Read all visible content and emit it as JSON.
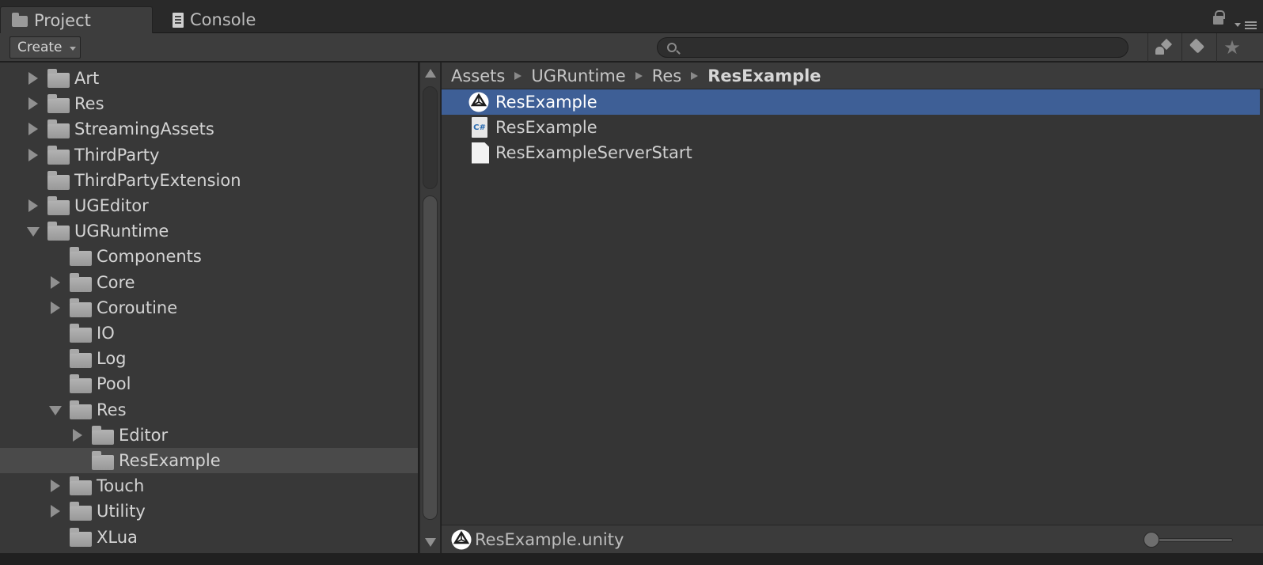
{
  "tabs": [
    {
      "label": "Project",
      "icon": "folder-icon",
      "active": true
    },
    {
      "label": "Console",
      "icon": "console-icon",
      "active": false
    }
  ],
  "toolbar": {
    "create_label": "Create",
    "search_placeholder": "",
    "icons": [
      "search-icon",
      "filter-by-type-icon",
      "filter-by-label-icon",
      "favorites-star-icon"
    ]
  },
  "tree": {
    "items": [
      {
        "label": "Art",
        "depth": 0,
        "expander": "collapsed"
      },
      {
        "label": "Res",
        "depth": 0,
        "expander": "collapsed"
      },
      {
        "label": "StreamingAssets",
        "depth": 0,
        "expander": "collapsed"
      },
      {
        "label": "ThirdParty",
        "depth": 0,
        "expander": "collapsed"
      },
      {
        "label": "ThirdPartyExtension",
        "depth": 0,
        "expander": "none"
      },
      {
        "label": "UGEditor",
        "depth": 0,
        "expander": "collapsed"
      },
      {
        "label": "UGRuntime",
        "depth": 0,
        "expander": "expanded"
      },
      {
        "label": "Components",
        "depth": 1,
        "expander": "none"
      },
      {
        "label": "Core",
        "depth": 1,
        "expander": "collapsed"
      },
      {
        "label": "Coroutine",
        "depth": 1,
        "expander": "collapsed"
      },
      {
        "label": "IO",
        "depth": 1,
        "expander": "none"
      },
      {
        "label": "Log",
        "depth": 1,
        "expander": "none"
      },
      {
        "label": "Pool",
        "depth": 1,
        "expander": "none"
      },
      {
        "label": "Res",
        "depth": 1,
        "expander": "expanded"
      },
      {
        "label": "Editor",
        "depth": 2,
        "expander": "collapsed"
      },
      {
        "label": "ResExample",
        "depth": 2,
        "expander": "none",
        "selected": true
      },
      {
        "label": "Touch",
        "depth": 1,
        "expander": "collapsed"
      },
      {
        "label": "Utility",
        "depth": 1,
        "expander": "collapsed"
      },
      {
        "label": "XLua",
        "depth": 1,
        "expander": "none"
      }
    ]
  },
  "breadcrumb": [
    "Assets",
    "UGRuntime",
    "Res",
    "ResExample"
  ],
  "files": [
    {
      "label": "ResExample",
      "icon": "unity-scene-icon",
      "selected": true
    },
    {
      "label": "ResExample",
      "icon": "csharp-script-icon",
      "selected": false
    },
    {
      "label": "ResExampleServerStart",
      "icon": "text-file-icon",
      "selected": false
    }
  ],
  "status": {
    "selected_path": "ResExample.unity",
    "icon": "unity-scene-icon",
    "zoom_fraction": 0.0
  },
  "colors": {
    "selection_blue": "#3e5f96",
    "panel_bg": "#383838"
  }
}
